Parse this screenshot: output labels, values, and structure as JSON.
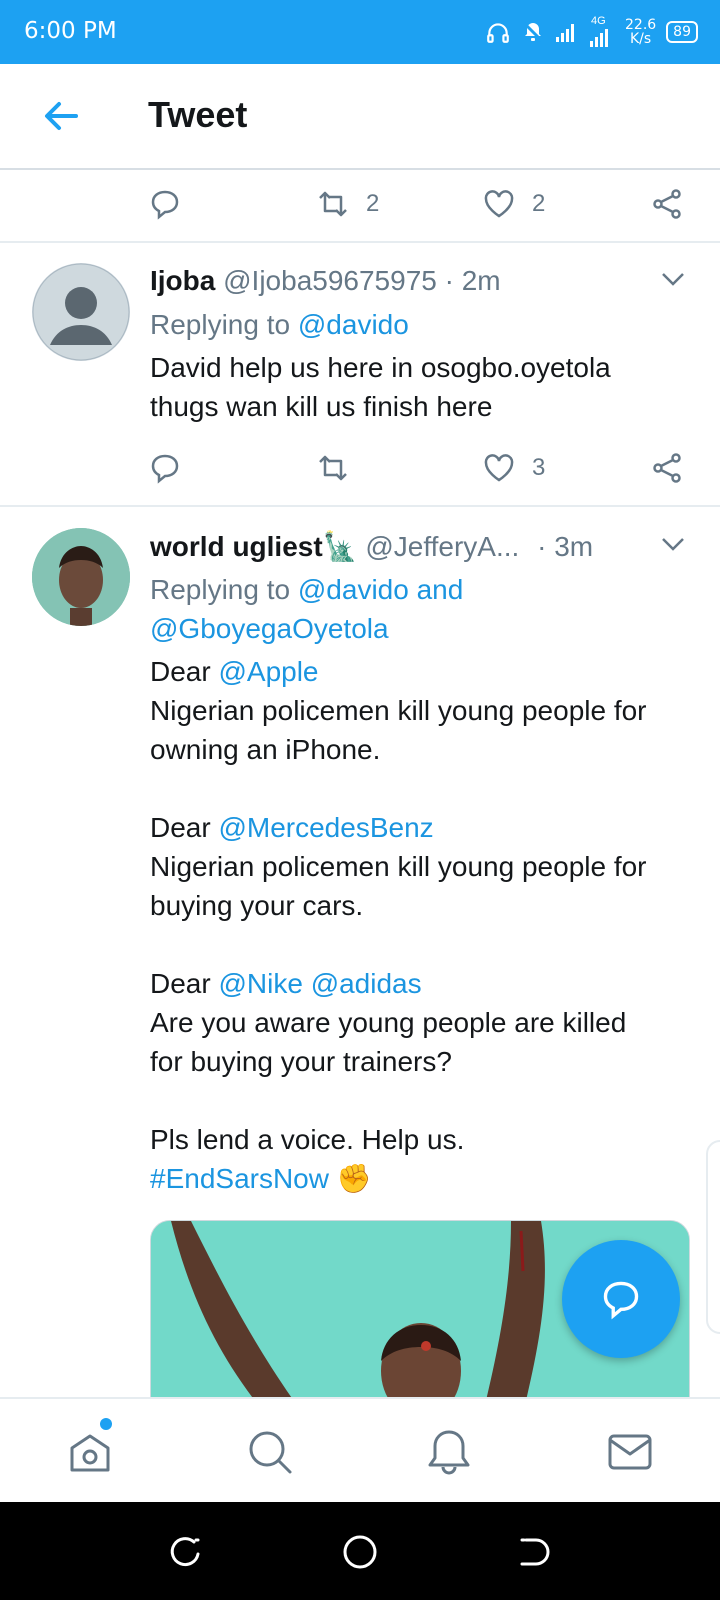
{
  "status_bar": {
    "time": "6:00 PM",
    "network": "4G",
    "speed_value": "22.6",
    "speed_unit": "K/s",
    "battery": "89",
    "background": "#1da1f2"
  },
  "header": {
    "title": "Tweet",
    "back_icon": "arrow-left-icon"
  },
  "top_actions": {
    "retweets": "2",
    "likes": "2"
  },
  "tweets": [
    {
      "name": "Ijoba",
      "handle": "@Ijoba59675975",
      "time": "· 2m",
      "replying_prefix": "Replying to ",
      "replying_to": "@davido",
      "text_line1": "David help us here in osogbo.oyetola",
      "text_line2": "thugs wan kill us finish here",
      "retweets": "",
      "likes": "3"
    },
    {
      "name": "world ugliest",
      "name_emoji": "🗽",
      "handle": "@JefferyA...",
      "time": "· 3m",
      "replying_prefix": "Replying to ",
      "replying_to_1": "@davido and",
      "replying_to_2": "@GboyegaOyetola",
      "p1_dear": "Dear ",
      "p1_mention": "@Apple",
      "p1_line1": "Nigerian policemen kill young people for",
      "p1_line2": "owning an iPhone.",
      "p2_dear": "Dear ",
      "p2_mention": "@MercedesBenz",
      "p2_line1": "Nigerian policemen kill young people for",
      "p2_line2": "buying your cars.",
      "p3_dear": "Dear ",
      "p3_mention1": "@Nike",
      "p3_mention2": "@adidas",
      "p3_line1": "Are you aware young people are killed",
      "p3_line2": "for buying your trainers?",
      "p4_line1": "Pls lend a voice. Help us.",
      "hashtag": "#EndSarsNow",
      "hashtag_emoji": "✊"
    }
  ],
  "colors": {
    "accent": "#1da1f2",
    "link": "#1b95e0",
    "muted": "#657786"
  },
  "bottom_nav": [
    "home-icon",
    "search-icon",
    "notifications-icon",
    "messages-icon"
  ]
}
